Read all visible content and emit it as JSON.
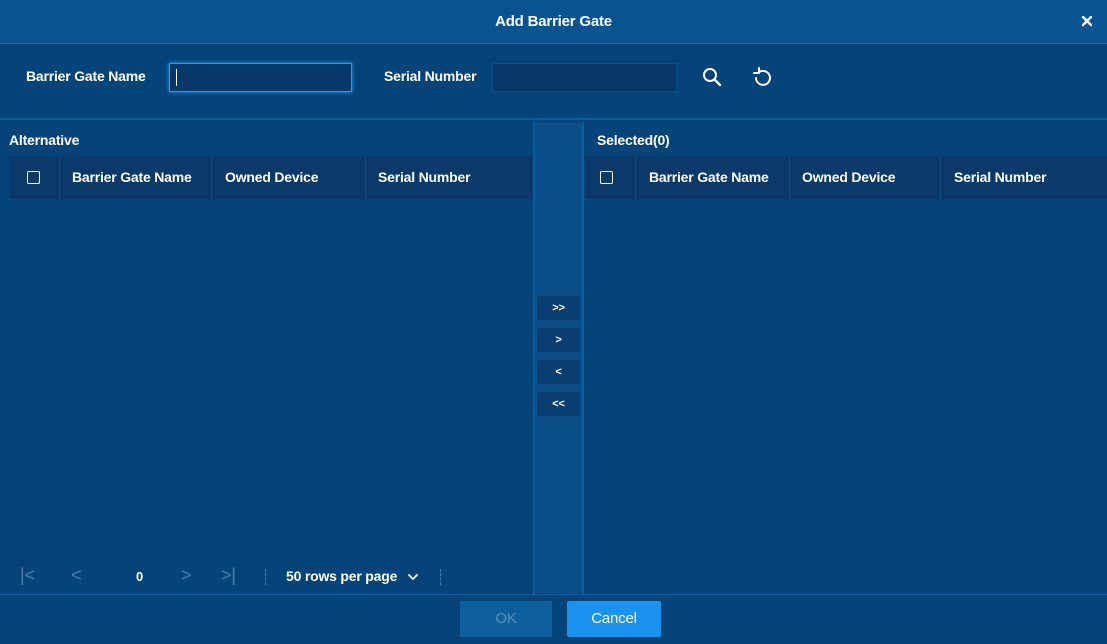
{
  "dialog": {
    "title": "Add Barrier Gate",
    "close_icon": "close-icon"
  },
  "search": {
    "name_label": "Barrier Gate Name",
    "name_value": "",
    "serial_label": "Serial Number",
    "serial_value": "",
    "search_icon": "search-icon",
    "reset_icon": "refresh-icon"
  },
  "alternative": {
    "title": "Alternative",
    "columns": [
      "Barrier Gate Name",
      "Owned Device",
      "Serial Number"
    ],
    "rows": []
  },
  "selected": {
    "title": "Selected(0)",
    "columns": [
      "Barrier Gate Name",
      "Owned Device",
      "Serial Number"
    ],
    "rows": []
  },
  "transfer": {
    "add_all": ">>",
    "add_one": ">",
    "remove_one": "<",
    "remove_all": "<<"
  },
  "pager": {
    "first": "|<",
    "prev": "<",
    "page": "0",
    "next": ">",
    "last": ">|",
    "rows_per_page": "50 rows per page"
  },
  "footer": {
    "ok": "OK",
    "cancel": "Cancel"
  },
  "colors": {
    "background": "#054479",
    "header": "#0a5391",
    "table_header": "#0b3a6a",
    "accent": "#1a93f0"
  }
}
